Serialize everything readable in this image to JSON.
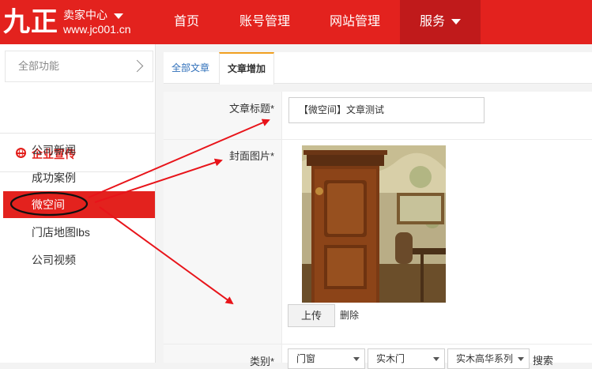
{
  "header": {
    "logo": "九正",
    "seller_center": "卖家中心",
    "domain": "www.jc001.cn",
    "nav": [
      {
        "label": "首页"
      },
      {
        "label": "账号管理"
      },
      {
        "label": "网站管理"
      },
      {
        "label": "服务"
      }
    ]
  },
  "sidebar": {
    "all_functions": "全部功能",
    "section_title": "企业宣传",
    "items": [
      {
        "label": "公司新闻"
      },
      {
        "label": "成功案例"
      },
      {
        "label": "微空间"
      },
      {
        "label": "门店地图lbs"
      },
      {
        "label": "公司视频"
      }
    ],
    "active_index": 2
  },
  "tabs": [
    {
      "label": "全部文章"
    },
    {
      "label": "文章增加"
    }
  ],
  "form": {
    "title_label": "文章标题*",
    "title_value": "【微空间】文章测试",
    "cover_label": "封面图片*",
    "upload_label": "上传",
    "delete_label": "删除",
    "category_label": "类别*",
    "categories": [
      "门窗",
      "实木门",
      "实木高华系列"
    ],
    "search_label": "搜索"
  },
  "colors": {
    "brand_red": "#e3221e",
    "nav_active": "#c01a1b",
    "tab_accent": "#f0a020",
    "annotation_red": "#e8141a"
  }
}
